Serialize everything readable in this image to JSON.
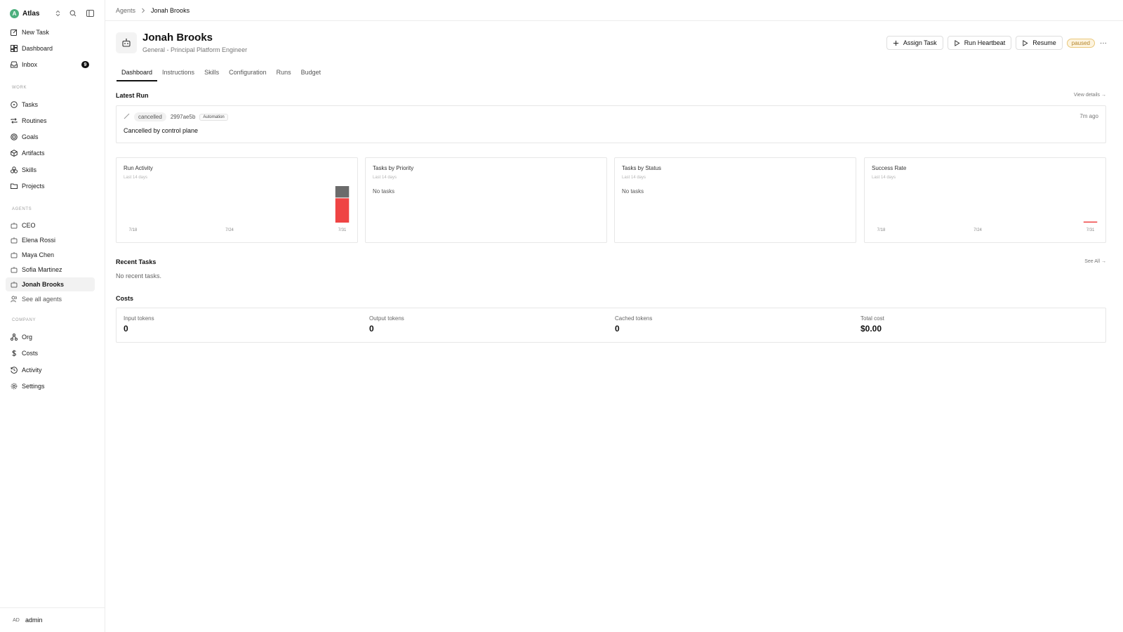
{
  "workspace": {
    "initial": "A",
    "name": "Atlas"
  },
  "sidebar": {
    "top_items": [
      {
        "label": "New Task",
        "icon": "edit-icon"
      },
      {
        "label": "Dashboard",
        "icon": "dashboard-icon"
      },
      {
        "label": "Inbox",
        "icon": "inbox-icon",
        "badge": "9"
      }
    ],
    "work_label": "WORK",
    "work_items": [
      {
        "label": "Tasks",
        "icon": "circle-icon"
      },
      {
        "label": "Routines",
        "icon": "repeat-icon"
      },
      {
        "label": "Goals",
        "icon": "target-icon"
      },
      {
        "label": "Artifacts",
        "icon": "box-icon"
      },
      {
        "label": "Skills",
        "icon": "boxes-icon"
      },
      {
        "label": "Projects",
        "icon": "folder-icon"
      }
    ],
    "agents_label": "AGENTS",
    "agent_items": [
      {
        "label": "CEO"
      },
      {
        "label": "Elena Rossi"
      },
      {
        "label": "Maya Chen"
      },
      {
        "label": "Sofia Martinez"
      },
      {
        "label": "Jonah Brooks",
        "active": true
      }
    ],
    "see_all": "See all agents",
    "company_label": "COMPANY",
    "company_items": [
      {
        "label": "Org",
        "icon": "org-icon"
      },
      {
        "label": "Costs",
        "icon": "dollar-icon"
      },
      {
        "label": "Activity",
        "icon": "history-icon"
      },
      {
        "label": "Settings",
        "icon": "gear-icon"
      }
    ],
    "user": {
      "initials": "AD",
      "name": "admin"
    }
  },
  "breadcrumb": {
    "parent": "Agents",
    "current": "Jonah Brooks"
  },
  "agent": {
    "name": "Jonah Brooks",
    "subtitle": "General - Principal Platform Engineer",
    "status": "paused"
  },
  "actions": {
    "assign": "Assign Task",
    "heartbeat": "Run Heartbeat",
    "resume": "Resume",
    "more": "···"
  },
  "tabs": [
    "Dashboard",
    "Instructions",
    "Skills",
    "Configuration",
    "Runs",
    "Budget"
  ],
  "latest_run": {
    "title": "Latest Run",
    "view_details": "View details →",
    "status": "cancelled",
    "hash": "2997ae5b",
    "tag": "Automation",
    "time": "7m ago",
    "message": "Cancelled by control plane"
  },
  "cards": {
    "run_activity": {
      "title": "Run Activity",
      "sub": "Last 14 days"
    },
    "priority": {
      "title": "Tasks by Priority",
      "sub": "Last 14 days",
      "empty": "No tasks"
    },
    "status": {
      "title": "Tasks by Status",
      "sub": "Last 14 days",
      "empty": "No tasks"
    },
    "success": {
      "title": "Success Rate",
      "sub": "Last 14 days"
    }
  },
  "chart_data": [
    {
      "type": "bar",
      "title": "Run Activity",
      "categories": [
        "7/18",
        "7/19",
        "7/20",
        "7/21",
        "7/22",
        "7/23",
        "7/24",
        "7/25",
        "7/26",
        "7/27",
        "7/28",
        "7/29",
        "7/30",
        "7/31"
      ],
      "tick_labels": [
        "7/18",
        "7/24",
        "7/31"
      ],
      "series": [
        {
          "values": [
            0,
            0,
            0,
            0,
            0,
            0,
            0,
            0,
            0,
            0,
            0,
            0,
            0,
            2
          ],
          "color": "#ef4444"
        },
        {
          "values": [
            0,
            0,
            0,
            0,
            0,
            0,
            0,
            0,
            0,
            0,
            0,
            0,
            0,
            1
          ],
          "color": "#6b6b6b"
        }
      ],
      "ylim": [
        0,
        3
      ]
    },
    {
      "type": "bar",
      "title": "Success Rate",
      "categories": [
        "7/18",
        "7/19",
        "7/20",
        "7/21",
        "7/22",
        "7/23",
        "7/24",
        "7/25",
        "7/26",
        "7/27",
        "7/28",
        "7/29",
        "7/30",
        "7/31"
      ],
      "tick_labels": [
        "7/18",
        "7/24",
        "7/31"
      ],
      "values": [
        null,
        null,
        null,
        null,
        null,
        null,
        null,
        null,
        null,
        null,
        null,
        null,
        null,
        0
      ],
      "color": "#ef4444",
      "ylim": [
        0,
        100
      ]
    }
  ],
  "recent_tasks": {
    "title": "Recent Tasks",
    "see_all": "See All →",
    "empty": "No recent tasks."
  },
  "costs": {
    "title": "Costs",
    "items": [
      {
        "label": "Input tokens",
        "value": "0"
      },
      {
        "label": "Output tokens",
        "value": "0"
      },
      {
        "label": "Cached tokens",
        "value": "0"
      },
      {
        "label": "Total cost",
        "value": "$0.00"
      }
    ]
  }
}
